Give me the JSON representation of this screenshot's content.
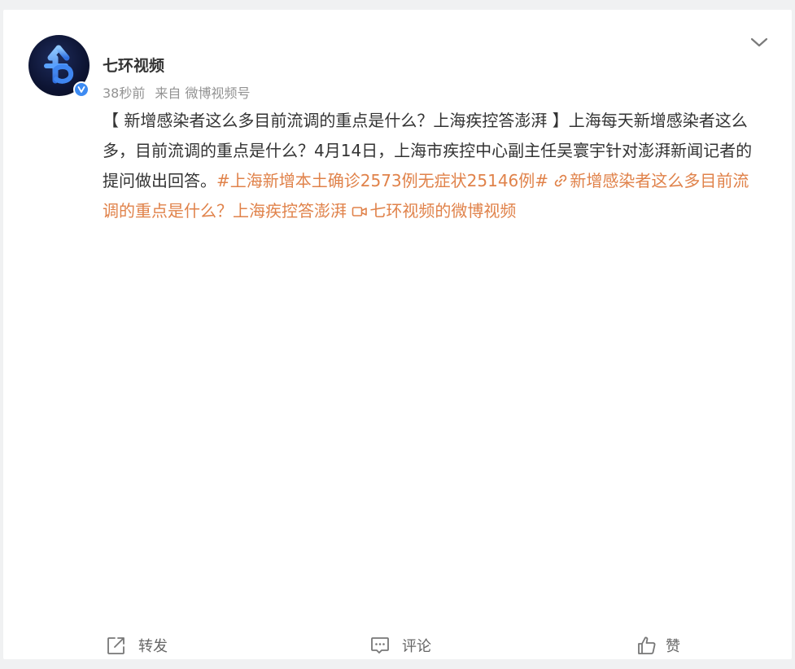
{
  "post": {
    "author": "七环视频",
    "time": "38秒前",
    "source_prefix": "来自",
    "source": "微博视频号",
    "text": {
      "lead": "【 新增感染者这么多目前流调的重点是什么？上海疾控答澎湃 】上海每天新增感染者这么多，目前流调的重点是什么？4月14日，上海市疾控中心副主任吴寰宇针对澎湃新闻记者的提问做出回答。",
      "hashtag": "#上海新增本土确诊2573例无症状25146例#",
      "link_text": "新增感染者这么多目前流调的重点是什么？上海疾控答澎湃",
      "video_source": "七环视频的微博视频"
    }
  },
  "actions": {
    "forward": "转发",
    "comment": "评论",
    "like": "赞"
  },
  "icons": {
    "more": "chevron-down-icon",
    "verified": "verified-v-icon",
    "link": "link-icon",
    "video": "video-camera-icon",
    "forward": "share-arrow-icon",
    "comment": "comment-bubble-icon",
    "like": "thumbs-up-icon"
  },
  "colors": {
    "highlight": "#e0824a",
    "text": "#333333",
    "meta": "#939393",
    "verified": "#3d8bf2",
    "background": "#f0f1f2",
    "card": "#ffffff"
  }
}
